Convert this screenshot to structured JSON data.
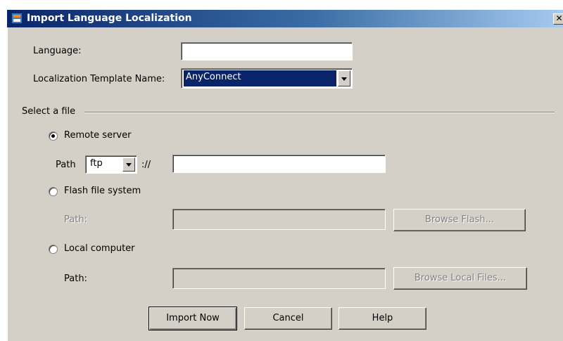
{
  "window": {
    "title": "Import Language Localization",
    "close_glyph": "✕"
  },
  "form": {
    "language_label": "Language:",
    "language_value": "",
    "template_label": "Localization Template Name:",
    "template_value": "AnyConnect"
  },
  "file_section": {
    "label": "Select a file",
    "remote": {
      "label": "Remote server",
      "checked": true,
      "path_label": "Path",
      "protocol": "ftp",
      "separator": "://",
      "path_value": ""
    },
    "flash": {
      "label": "Flash file system",
      "checked": false,
      "path_label": "Path:",
      "path_value": "",
      "browse_label": "Browse Flash..."
    },
    "local": {
      "label": "Local computer",
      "checked": false,
      "path_label": "Path:",
      "path_value": "",
      "browse_label": "Browse Local Files..."
    }
  },
  "buttons": {
    "import": "Import Now",
    "cancel": "Cancel",
    "help": "Help"
  },
  "colors": {
    "titlebar_start": "#0a246a",
    "titlebar_end": "#a6caf0",
    "dialog_bg": "#d4d0c8",
    "selection": "#0a246a"
  }
}
